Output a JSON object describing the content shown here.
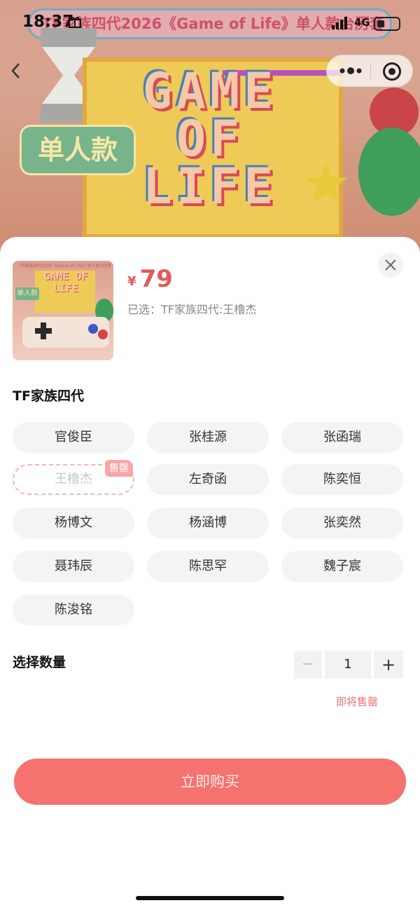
{
  "status_bar": {
    "time": "18:37",
    "network": "4G"
  },
  "banner": {
    "title": "TF家族四代2026《Game of Life》单人款台历套装",
    "board_text": "GAME OF LIFE",
    "tag": "单人款"
  },
  "product": {
    "thumb_text": "TF家族四代2026《Game of Life》单人款台历套装",
    "thumb_board_text": "GAME OF LIFE",
    "thumb_tag": "单人款",
    "currency": "¥",
    "price": "79",
    "selected_label": "已选：TF家族四代:王橹杰"
  },
  "option_group": {
    "title": "TF家族四代",
    "options": [
      {
        "label": "官俊臣",
        "sold_out": false
      },
      {
        "label": "张桂源",
        "sold_out": false
      },
      {
        "label": "张函瑞",
        "sold_out": false
      },
      {
        "label": "王橹杰",
        "sold_out": true,
        "badge": "售罄"
      },
      {
        "label": "左奇函",
        "sold_out": false
      },
      {
        "label": "陈奕恒",
        "sold_out": false
      },
      {
        "label": "杨博文",
        "sold_out": false
      },
      {
        "label": "杨涵博",
        "sold_out": false
      },
      {
        "label": "张奕然",
        "sold_out": false
      },
      {
        "label": "聂玮辰",
        "sold_out": false
      },
      {
        "label": "陈思罕",
        "sold_out": false
      },
      {
        "label": "魏子宸",
        "sold_out": false
      },
      {
        "label": "陈浚铭",
        "sold_out": false
      }
    ]
  },
  "quantity": {
    "title": "选择数量",
    "minus": "−",
    "value": "1",
    "plus": "+",
    "hint": "即将售罄"
  },
  "buy_button": "立即购买",
  "colors": {
    "accent": "#f5726f",
    "price": "#e05b5b",
    "soldout_badge": "#f7a6a6"
  }
}
